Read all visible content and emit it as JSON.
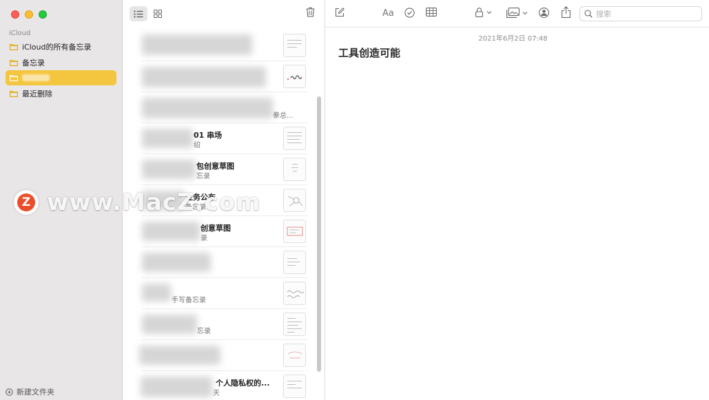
{
  "sidebar": {
    "section_label": "iCloud",
    "folders": [
      {
        "label": "iCloud的所有备忘录"
      },
      {
        "label": "备忘录"
      },
      {
        "label": ""
      },
      {
        "label": "最近删除"
      }
    ],
    "new_folder_label": "新建文件夹"
  },
  "notes": [
    {
      "title": "",
      "sub": ""
    },
    {
      "title": "",
      "sub": ""
    },
    {
      "title": "",
      "sub": "豢总..."
    },
    {
      "title": "01 串场",
      "sub": "绍"
    },
    {
      "title": "包创意草图",
      "sub": "忘录"
    },
    {
      "title": "业务公布",
      "sub": "备忘录"
    },
    {
      "title": "创意草图",
      "sub": "录"
    },
    {
      "title": "",
      "sub": ""
    },
    {
      "title": "",
      "sub": "手写备忘录"
    },
    {
      "title": "",
      "sub": "忘录"
    },
    {
      "title": "",
      "sub": ""
    },
    {
      "title": "个人隐私权的...",
      "sub": "天"
    }
  ],
  "editor": {
    "search_placeholder": "搜索",
    "timestamp": "2021年6月2日 07:48",
    "note_title": "工具创造可能",
    "format_label": "Aa"
  },
  "watermark": {
    "logo_letter": "Z",
    "text": "www.MacZ.com"
  },
  "colors": {
    "selected_folder": "#f4c640",
    "folder_icon": "#e0a800",
    "sidebar_bg": "#e8e6e6"
  }
}
